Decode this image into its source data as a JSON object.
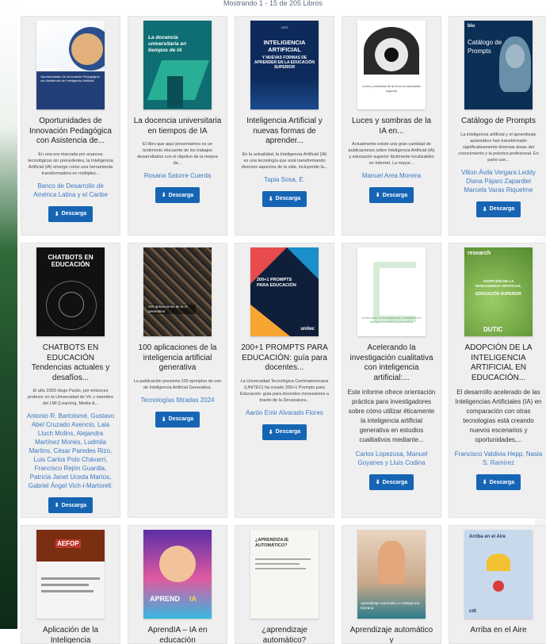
{
  "page": {
    "counter": "Mostrando 1 - 15 de 205 Libros"
  },
  "download_label": "Descarga",
  "download_icon": "download-icon",
  "books": [
    {
      "title": "Oportunidades de Innovación Pedagógica con Asistencia de...",
      "desc": "En una era marcada por avances tecnológicos sin precedentes, la Inteligencia Artificial (IA) emerge como una herramienta transformadora en múltiples...",
      "author": "Banco de Desarrollo de América Latina y el Caribe",
      "cover": {
        "t1": "INFORME",
        "t2": "Oportunidades de Innovación Pedagógica con Asistencia de Inteligencia Artificial"
      }
    },
    {
      "title": "La docencia universitaria en tiempos de IA",
      "desc": "El libro que aquí presentamos es un testimonio elocuente de los trabajos desarrollados con el objetivo de la mejora de...",
      "author": "Rosana Satorre Cuerda",
      "cover": {
        "t1": "La docencia universitaria en tiempos de IA"
      }
    },
    {
      "title": "Inteligencia Artificial y nuevas formas de aprender...",
      "desc": "En la actualidad, la Inteligencia Artificial (IA) es una tecnología que está transformando diversos aspectos de la vida, incluyendo la...",
      "author": "Tapia Sosa, E.",
      "cover": {
        "t1": "2023",
        "t2": "INTELIGENCIA ARTIFICIAL",
        "t3": "Y NUEVAS FORMAS DE APRENDER EN LA EDUCACIÓN SUPERIOR"
      }
    },
    {
      "title": "Luces y sombras de la IA en...",
      "desc": "Actualmente existe una gran cantidad de publicaciones sobre Inteligencia Artificial (IA) y educación superior fácilmente localizables en Internet. La mayor...",
      "author": "Manuel Area Moreira",
      "cover": {
        "t1": "Luces y sombras de la IA en la educación superior"
      }
    },
    {
      "title": "Catálogo de Prompts",
      "desc": "La inteligencia artificial y el aprendizaje automático han transformado significativamente diversas áreas del conocimiento y la práctica profesional. En parte use...",
      "author": "Vilton Ávila Vergara Leddy Diana Pájaro Zapardiel Marcela Varas Riquelme",
      "cover": {
        "t1": "biu",
        "t2": "Catálogo de Prompts"
      }
    },
    {
      "title": "CHATBOTS EN EDUCACIÓN Tendencias actuales y desafíos...",
      "desc": "El año 2009 Hugo Pardo, por entonces profesor en la Universidad de Vic y miembro del LMI (Learning, Media &...",
      "author": "Antonio R. Bartolomé, Gustavo Abel Cruzado Asencio, Laia Lluch Molins, Alejandra Martínez Monés, Ludmila Martins, César Paredes Rizo, Luis Carlos Polo Chávarri, Francisco Rejón Guardia, Patricia Janet Uceda Martos, Gabriel Ángel Vich-i-Martorell.",
      "cover": {
        "t1": "CHATBOTS EN EDUCACIÓN"
      }
    },
    {
      "title": "100 aplicaciones de la inteligencia artificial generativa",
      "desc": "La publicación presenta 100 ejemplos de uso de Inteligencia Artificial Generativa.",
      "author": "Tecnologías filtradas 2024",
      "cover": {
        "t1": "100 aplicaciones de la IA generativa"
      }
    },
    {
      "title": "200+1 PROMPTS PARA EDUCACIÓN: guía para docentes...",
      "desc": "La Universidad Tecnológica Centroamericana (UNITEC) ha creado 200+1 Prompts para Educación: guía para docentes innovadores a través de la Decanatura...",
      "author": "Aarón Emir Alvarado Flores",
      "cover": {
        "t1": "200+1 PROMPTS PARA EDUCACIÓN",
        "t2": "unitec"
      }
    },
    {
      "title": "Acelerando la investigación cualitativa con inteligencia artificial:...",
      "desc": "Este informe ofrece orientación práctica para investigadores sobre cómo utilizar éticamente la inteligencia artificial generativa en estudios cualitativos mediante...",
      "author": "Carlos Lopezosa, Manuel Goyanes y Lluís Codina",
      "cover": {
        "t1": "Acelerando la investigación cualitativa con inteligencia artificial generativa"
      }
    },
    {
      "title": "ADOPCIÓN DE LA INTELIGENCIA ARTIFICIAL EN EDUCACIÓN...",
      "desc": "El desarrollo acelerado de las Inteligencias Artificiales (IA) en comparación con otras tecnologías está creando nuevos escenarios y oportunidades,...",
      "author": "Francisco Valdivia Hepp, Nasla S. Ramírez",
      "cover": {
        "t1": "research",
        "t2": "ADOPCIÓN DE LA INTELIGENCIA ARTIFICIAL",
        "t3": "EDUCACIÓN SUPERIOR",
        "t4": "DUTIC"
      }
    },
    {
      "title": "Aplicación de la Inteligencia",
      "cover": {
        "t1": "AEFOP"
      }
    },
    {
      "title": "AprendIA – IA en educación",
      "cover": {
        "t1": "APREND",
        "t2": "IA"
      }
    },
    {
      "title": "¿aprendizaje automático?",
      "cover": {
        "t1": "¿APRENDIZAJE AUTOMÁTICO?"
      }
    },
    {
      "title": "Aprendizaje automático y",
      "cover": {
        "t1": "Aprendizaje automático e inteligencia humana"
      }
    },
    {
      "title": "Arriba en el Aire",
      "cover": {
        "t1": "Arriba en el Aire",
        "t2": "cdt"
      }
    }
  ],
  "colors": {
    "button": "#1665b5",
    "author_link": "#3b78c2",
    "card_bg": "#efefef"
  }
}
